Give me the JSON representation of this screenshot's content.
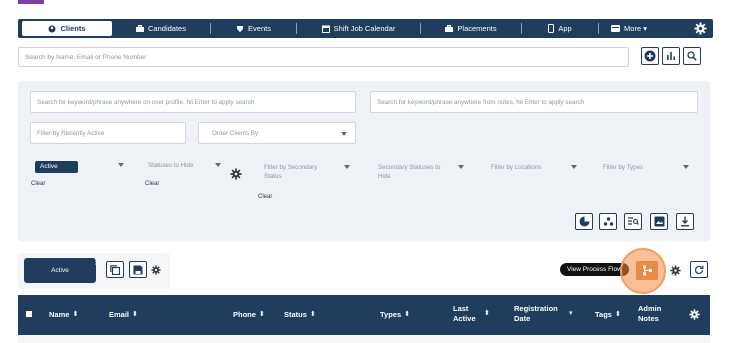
{
  "nav": {
    "tabs": [
      {
        "label": "Clients",
        "icon": "people-icon",
        "active": true
      },
      {
        "label": "Candidates",
        "icon": "briefcase-icon"
      },
      {
        "label": "Events",
        "icon": "trophy-icon"
      },
      {
        "label": "Shift Job Calendar",
        "icon": "calendar-icon"
      },
      {
        "label": "Placements",
        "icon": "briefcase-icon"
      },
      {
        "label": "App",
        "icon": "phone-icon"
      },
      {
        "label": "More ▾",
        "icon": "card-icon"
      }
    ]
  },
  "search": {
    "placeholder": "Search by Name, Email or Phone Number"
  },
  "filters": {
    "profile_search": "Search for keyword/phrase anywhere on user profile, hit Enter to apply search",
    "notes_search": "Search for keyword/phrase anywhere from notes, hit Enter to apply search",
    "recently_active": "Filter by Recently Active",
    "order_by": "Order Clients By",
    "status_value": "Active",
    "statuses_hide": "Statuses to Hide",
    "secondary_status": "Filter by Secondary Status",
    "secondary_hide": "Secondary Statuses to Hide",
    "locations": "Filter by Locations",
    "types": "Filter by Types",
    "clear": "Clear"
  },
  "saved_filter": {
    "label": "Active",
    "menu": "⋮"
  },
  "tooltip": "View Process Flow",
  "table": {
    "columns": [
      {
        "label": "Name",
        "sortable": true
      },
      {
        "label": "Email",
        "sortable": true
      },
      {
        "label": "Phone",
        "sortable": true
      },
      {
        "label": "Status",
        "sortable": true
      },
      {
        "label": "Types",
        "sortable": true
      },
      {
        "label": "Last Active",
        "sortable": true
      },
      {
        "label": "Registration Date",
        "sortable": true
      },
      {
        "label": "Tags",
        "sortable": true
      },
      {
        "label": "Admin Notes",
        "sortable": false
      }
    ]
  },
  "colors": {
    "navy": "#1f3d5c",
    "accent": "#e98b45",
    "panel": "#eef1f5"
  }
}
